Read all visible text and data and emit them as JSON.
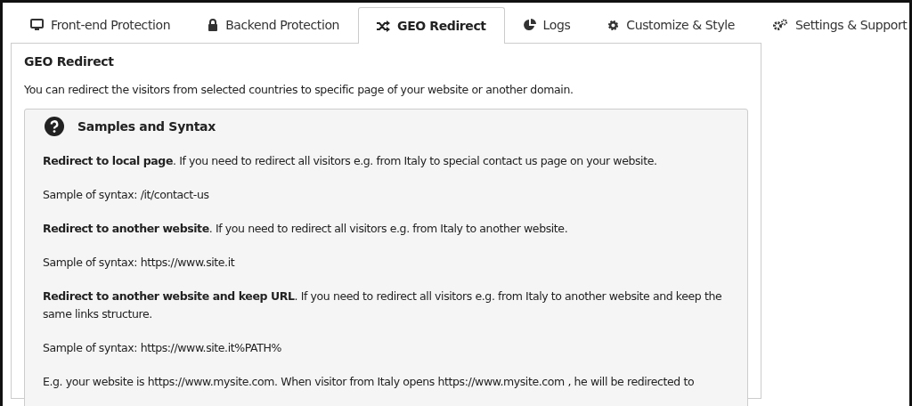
{
  "tabs": [
    {
      "label": "Front-end Protection",
      "selected": false
    },
    {
      "label": "Backend Protection",
      "selected": false
    },
    {
      "label": "GEO Redirect",
      "selected": true
    },
    {
      "label": "Logs",
      "selected": false
    },
    {
      "label": "Customize & Style",
      "selected": false
    },
    {
      "label": "Settings & Support",
      "selected": false
    }
  ],
  "panel": {
    "title": "GEO Redirect",
    "description": "You can redirect the visitors from selected countries to specific page of your website or another domain.",
    "help_box": {
      "title": "Samples and Syntax",
      "paragraphs": [
        "**Redirect to local page**. If you need to redirect all visitors e.g. from Italy to special contact us page on your website.",
        "Sample of syntax: /it/contact-us",
        "**Redirect to another website**. If you need to redirect all visitors e.g. from Italy to another website.",
        "Sample of syntax: https://www.site.it",
        "**Redirect to another website and keep URL**. If you need to redirect all visitors e.g. from Italy to another website and keep the same links structure.",
        "Sample of syntax: https://www.site.it%PATH%",
        "E.g. your website is https://www.mysite.com. When visitor from Italy opens https://www.mysite.com , he will be redirected to"
      ]
    }
  }
}
